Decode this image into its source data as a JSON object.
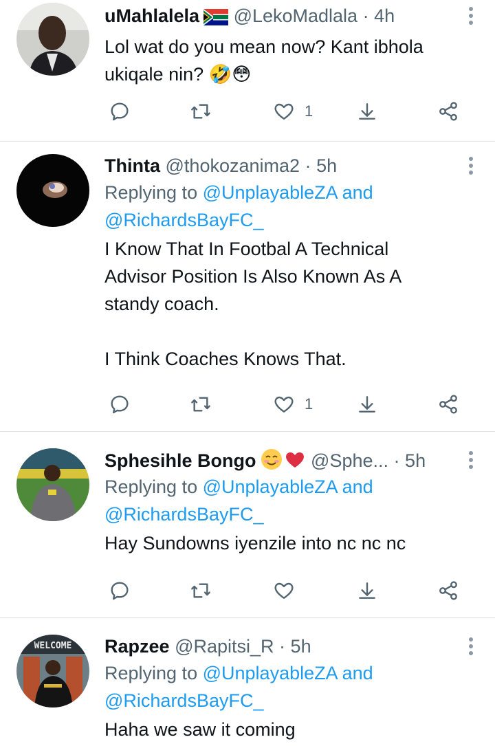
{
  "tweets": [
    {
      "name": "uMahlalela",
      "handle": "@LekoMadlala",
      "separator": "·",
      "time": "4h",
      "flag": "south-africa-flag",
      "body": [
        "Lol wat do you mean now? Kant ibhola",
        "ukiqale nin? 🤣😳"
      ],
      "like_count": "1"
    },
    {
      "name": "Thinta",
      "handle": "@thokozanima2",
      "separator": "·",
      "time": "5h",
      "replying_prefix": "Replying to",
      "replying_mention_1": "@UnplayableZA",
      "replying_and": "and",
      "replying_mention_2": "@RichardsBayFC_",
      "body": [
        "I Know That In Footbal A Technical",
        "Advisor Position Is Also Known As A",
        "standy coach.",
        "",
        "I Think Coaches Knows That."
      ],
      "like_count": "1"
    },
    {
      "name": "Sphesihle Bongo",
      "handle": "@Sphe...",
      "separator": "·",
      "time": "5h",
      "name_emoji": "☺️❤️",
      "replying_prefix": "Replying to",
      "replying_mention_1": "@UnplayableZA",
      "replying_and": "and",
      "replying_mention_2": "@RichardsBayFC_",
      "body": [
        "Hay Sundowns iyenzile into nc nc nc"
      ],
      "like_count": ""
    },
    {
      "name": "Rapzee",
      "handle": "@Rapitsi_R",
      "separator": "·",
      "time": "5h",
      "avatar_text": "WELCOME",
      "replying_prefix": "Replying to",
      "replying_mention_1": "@UnplayableZA",
      "replying_and": "and",
      "replying_mention_2": "@RichardsBayFC_",
      "body": [
        "Haha we saw it coming"
      ]
    }
  ],
  "colors": {
    "text": "#0f1419",
    "secondary": "#536471",
    "link": "#1d9bf0",
    "divider": "#dfe3e7"
  }
}
